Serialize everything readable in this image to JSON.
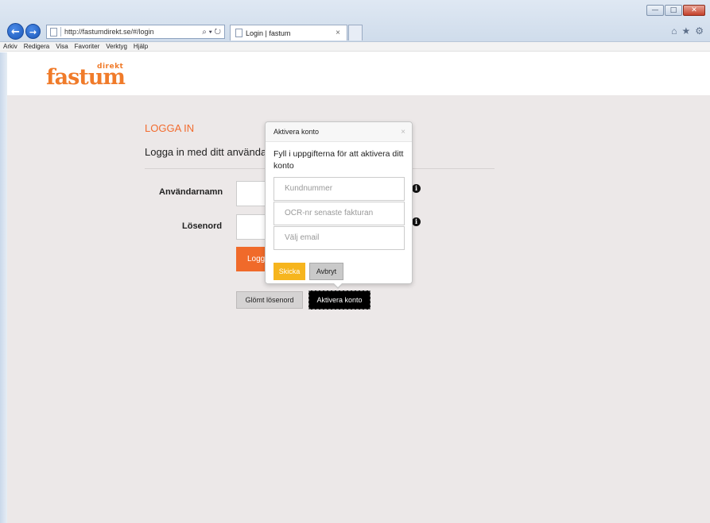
{
  "browser": {
    "url": "http://fastumdirekt.se/#/login",
    "address_tools": "⌕ ▾ ↻",
    "tab_title": "Login | fastum",
    "tab_close": "×",
    "window_buttons": {
      "minimize": "—",
      "maximize": "□",
      "close": "✕"
    },
    "right_icons": {
      "home": "⌂",
      "favorites": "★",
      "settings": "⚙"
    },
    "menu": [
      "Arkiv",
      "Redigera",
      "Visa",
      "Favoriter",
      "Verktyg",
      "Hjälp"
    ]
  },
  "site": {
    "logo_main": "fastum",
    "logo_sub": "direkt",
    "brand_color": "#f07b2a"
  },
  "login": {
    "heading": "LOGGA IN",
    "intro": "Logga in med ditt användarnamn",
    "username_label": "Användarnamn",
    "password_label": "Lösenord",
    "login_button": "Logga in",
    "forgot_button": "Glömt lösenord",
    "activate_button": "Aktivera konto"
  },
  "popover": {
    "title": "Aktivera konto",
    "close": "×",
    "text": "Fyll i uppgifterna för att aktivera ditt konto",
    "customer_number_placeholder": "Kundnummer",
    "ocr_placeholder": "OCR-nr senaste fakturan",
    "email_placeholder": "Välj email",
    "submit_button": "Skicka",
    "cancel_button": "Avbryt"
  },
  "icons": {
    "info": "i",
    "back": "←",
    "forward": "→"
  }
}
